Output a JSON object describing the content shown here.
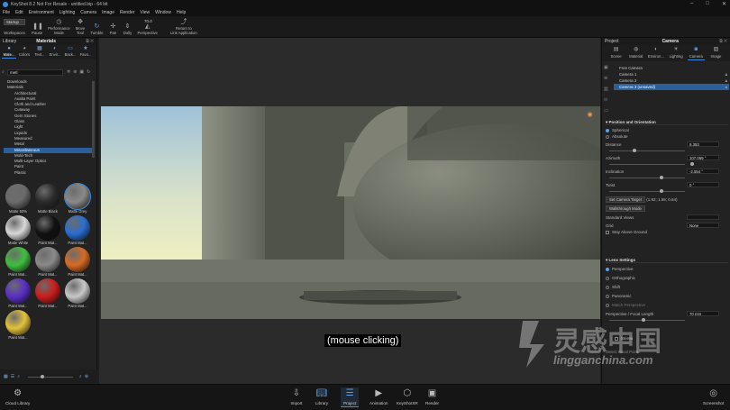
{
  "window": {
    "title": "KeyShot 8.2 Not For Resale - untitled.bip - 64 bit",
    "controls": [
      "–",
      "□",
      "✕"
    ]
  },
  "menu": [
    "File",
    "Edit",
    "Environment",
    "Lighting",
    "Camera",
    "Image",
    "Render",
    "View",
    "Window",
    "Help"
  ],
  "toolbar": {
    "workspace_value": "Startup",
    "items": [
      {
        "label": "Workspaces",
        "icon": "workspaces-icon"
      },
      {
        "label": "Pause",
        "icon": "pause-icon"
      },
      {
        "label": "Performance\nMode",
        "icon": "performance-icon"
      },
      {
        "label": "Move\nTool",
        "icon": "move-tool-icon"
      },
      {
        "label": "Tumble",
        "icon": "tumble-icon"
      },
      {
        "label": "Pan",
        "icon": "pan-icon"
      },
      {
        "label": "Dolly",
        "icon": "dolly-icon"
      },
      {
        "label": "Perspective",
        "icon": "perspective-icon"
      },
      {
        "label": "Return to\nLink Application",
        "icon": "return-icon"
      }
    ],
    "zoom_value": "70.0"
  },
  "library": {
    "panel_title": "Library",
    "panel_subtitle": "Materials",
    "tabs": [
      "Mate...",
      "Colors",
      "Text...",
      "Envir...",
      "Back...",
      "Favo..."
    ],
    "search_value": "metl",
    "tree": [
      "Downloads",
      "Materials",
      "Architectural",
      "Axalta Paint",
      "Cloth and Leather",
      "Cutaway",
      "Gem Stones",
      "Glass",
      "Light",
      "Liquids",
      "Measured",
      "Metal",
      "Miscellaneous",
      "Mold-Tech",
      "Multi-Layer Optics",
      "Paint",
      "Plastic"
    ],
    "selected_tree_index": 12,
    "swatches": [
      {
        "name": "Matte 50%",
        "color": "#6b6b6b"
      },
      {
        "name": "Matte Black",
        "color": "#2a2a2a"
      },
      {
        "name": "Matte Grey",
        "color": "#8a8a8a"
      },
      {
        "name": "Matte White",
        "color": "#d8d8d8"
      },
      {
        "name": "Paint Mat...",
        "color": "#111111"
      },
      {
        "name": "Paint Mat...",
        "color": "#2a6ed1"
      },
      {
        "name": "Paint Mat...",
        "color": "#3fbf3f"
      },
      {
        "name": "Paint Mat...",
        "color": "#8a8a8a"
      },
      {
        "name": "Paint Mat...",
        "color": "#d86a24"
      },
      {
        "name": "Paint Mat...",
        "color": "#5a2fc6"
      },
      {
        "name": "Paint Mat...",
        "color": "#cc1c1c"
      },
      {
        "name": "Paint Mat...",
        "color": "#c8c8c8"
      },
      {
        "name": "Paint Mat...",
        "color": "#e3c23a"
      }
    ]
  },
  "viewport": {
    "subtitle": "(mouse clicking)"
  },
  "project": {
    "panel_title": "Project",
    "panel_subtitle": "Camera",
    "tabs": [
      "Scene",
      "Material",
      "Environ...",
      "Lighting",
      "Camera",
      "Image"
    ],
    "cameras": [
      "Free Camera",
      "Camera 1",
      "Camera 2",
      "Camera 3 (unsaved)"
    ],
    "selected_camera_index": 3,
    "position": {
      "title": "Position and Orientation",
      "mode_spherical": "Spherical",
      "mode_absolute": "Absolute",
      "distance_label": "Distance",
      "distance_value": "9.353",
      "azimuth_label": "Azimuth",
      "azimuth_value": "107.069 °",
      "inclination_label": "Inclination",
      "inclination_value": "-2.554 °",
      "twist_label": "Twist",
      "twist_value": "0 °",
      "target_button": "Set Camera Target",
      "target_value": "(1.92; 1.55; 0.64)",
      "walkthrough_button": "Walkthrough Mode",
      "standard_views_label": "Standard Views",
      "grid_label": "Grid",
      "grid_value": "None",
      "stay_above_label": "Stay Above Ground"
    },
    "lens": {
      "title": "Lens Settings",
      "options": [
        "Perspective",
        "Orthographic",
        "Shift",
        "Panoramic"
      ],
      "match_perspective": "Match Perspective",
      "focal_label": "Perspective / Focal Length",
      "focal_value": "70 mm",
      "stereo_label": "Stereo",
      "select_focal": "Select Focal Point"
    }
  },
  "bottombar": {
    "cloud_label": "Cloud Library",
    "items": [
      "Import",
      "Library",
      "Project",
      "Animation",
      "KeyShotXR",
      "Render"
    ],
    "active_index": 2,
    "screenshot_label": "Screenshot"
  },
  "watermark": {
    "cn": "灵感中国",
    "url": "lingganchina.com"
  }
}
